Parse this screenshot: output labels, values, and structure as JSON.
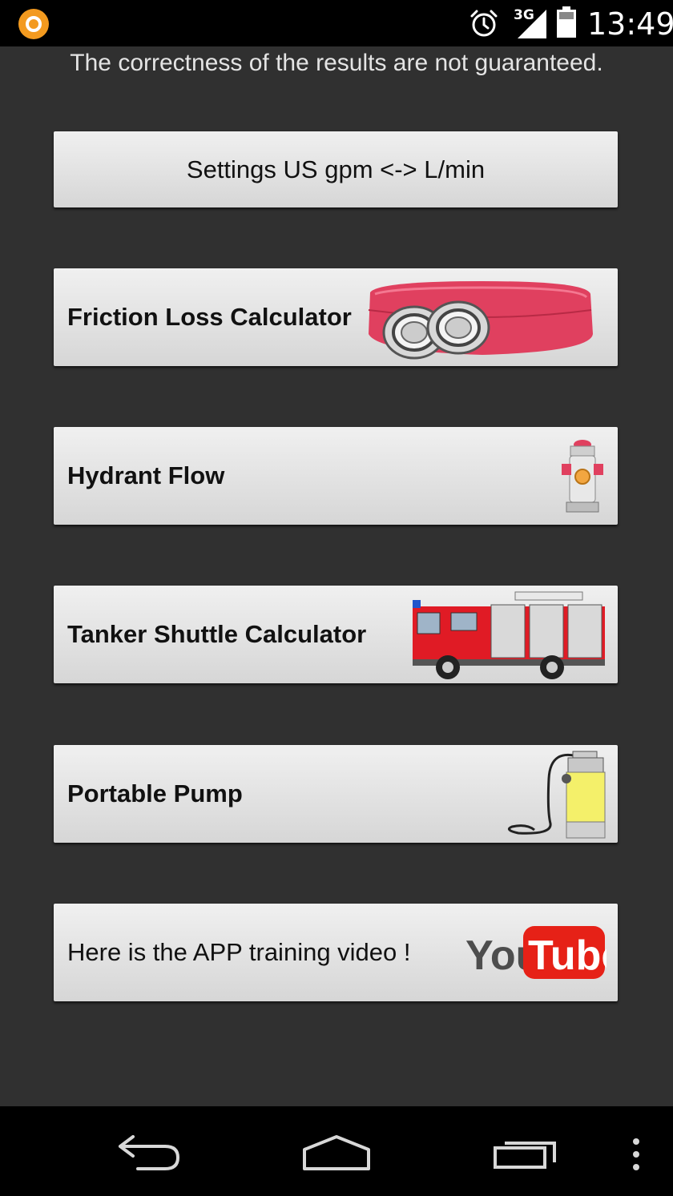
{
  "status_bar": {
    "network_type": "3G",
    "time": "13:49"
  },
  "disclaimer": "The correctness of the results are not guaranteed.",
  "menu": {
    "settings": {
      "label": "Settings US gpm <-> L/min"
    },
    "friction_loss": {
      "label": "Friction Loss Calculator",
      "icon": "fire-hose-icon"
    },
    "hydrant_flow": {
      "label": "Hydrant Flow",
      "icon": "fire-hydrant-icon"
    },
    "tanker_shuttle": {
      "label": "Tanker Shuttle Calculator",
      "icon": "fire-truck-icon"
    },
    "portable_pump": {
      "label": "Portable Pump",
      "icon": "portable-pump-icon"
    },
    "training_video": {
      "label": "Here is the APP training video !",
      "logo_you": "You",
      "logo_tube": "Tube"
    }
  },
  "colors": {
    "background": "#303030",
    "button_top": "#f0f0f0",
    "button_bottom": "#d6d6d6",
    "hose_red": "#e0405f",
    "youtube_red": "#e62117"
  }
}
